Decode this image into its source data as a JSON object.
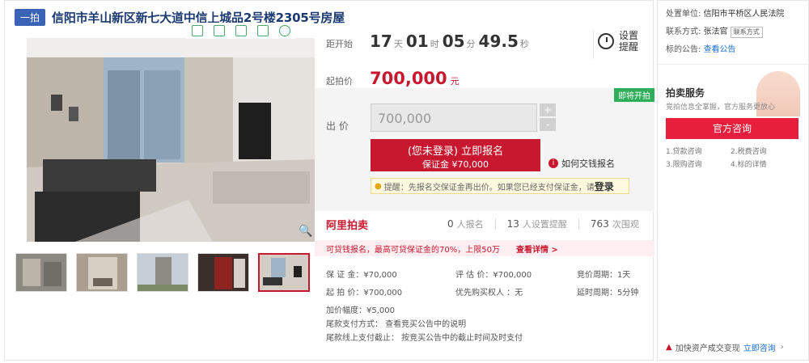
{
  "title": {
    "badge": "一拍",
    "text": "信阳市羊山新区新七大道中信上城品2号楼2305号房屋"
  },
  "countdown": {
    "label": "距开始",
    "days": "17",
    "days_unit": "天",
    "hours": "01",
    "hours_unit": "时",
    "minutes": "05",
    "minutes_unit": "分",
    "seconds": "49.5",
    "seconds_unit": "秒"
  },
  "remind": {
    "text": "设置提醒"
  },
  "start_price": {
    "label": "起拍价",
    "value": "700,000",
    "unit": "元"
  },
  "bid": {
    "tag": "即将开拍",
    "label": "出 价",
    "input_value": "700,000",
    "plus": "+",
    "minus": "-",
    "register_line1": "(您未登录) 立即报名",
    "register_line2": "保证金 ¥70,000",
    "howto": "如何交钱报名",
    "tip_text": "提醒：先报名交保证金再出价。如果您已经支付保证金，请",
    "tip_login": "登录"
  },
  "ali": {
    "logo": "阿里拍卖",
    "signups": "0",
    "signups_label": "人报名",
    "reminders": "13",
    "reminders_label": "人设置提醒",
    "views": "763",
    "views_label": "次围观"
  },
  "loan": {
    "text": "可贷钱报名，最高可贷保证金的70%，上限50万",
    "link": "查看详情 >"
  },
  "info": {
    "deposit": "保 证 金：¥70,000",
    "appraisal": "评 估 价：¥700,000",
    "cycle": "竞价周期：1天",
    "start": "起 拍 价：¥700,000",
    "priority": "优先购买权人 ：无",
    "delay": "延时周期：5分钟",
    "increment": "加价幅度：¥5,000",
    "payment": "尾款支付方式：  查看竞买公告中的说明",
    "deadline": "尾款线上支付截止：  按竞买公告中的截止时间及时支付"
  },
  "court": {
    "unit_label": "处置单位:",
    "unit": "信阳市平桥区人民法院",
    "contact_label": "联系方式:",
    "contact": "张法官",
    "contact_btn": "联系方式",
    "notice_label": "标的公告:",
    "notice_link": "查看公告"
  },
  "service": {
    "title": "拍卖服务",
    "subtitle": "竞拍信息全掌握，官方服务更放心",
    "consult": "官方咨询",
    "links": [
      "1.贷款咨询",
      "2.税费咨询",
      "3.限购咨询",
      "4.标的详情"
    ]
  },
  "speed": {
    "text": "加快资产成交变现",
    "link": "立即咨询"
  },
  "thumbnail_count": 5,
  "colors": {
    "accent_red": "#c8182f",
    "title_blue": "#1b3a72",
    "tag_green": "#2fae59",
    "link_blue": "#1b6ed1"
  }
}
